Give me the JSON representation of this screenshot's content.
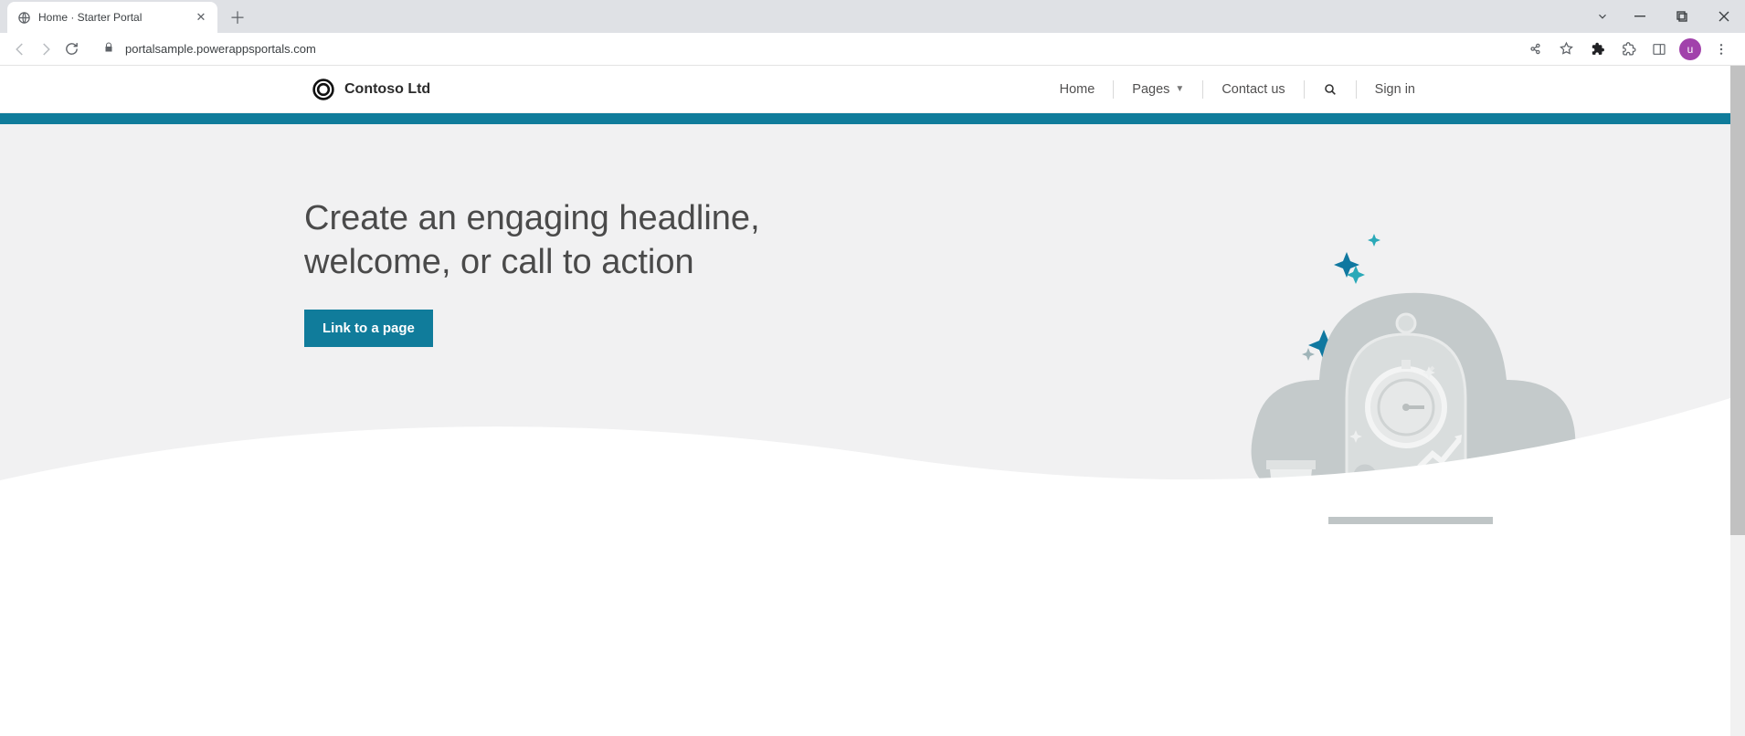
{
  "browser": {
    "tab_title": "Home  · Starter Portal",
    "url": "portalsample.powerappsportals.com",
    "profile_initial": "u"
  },
  "site": {
    "brand": "Contoso Ltd",
    "nav": {
      "home": "Home",
      "pages": "Pages",
      "contact": "Contact us",
      "signin": "Sign in"
    }
  },
  "hero": {
    "headline": "Create an engaging headline, welcome, or call to action",
    "cta_label": "Link to a page"
  },
  "colors": {
    "teal": "#107c9b"
  }
}
